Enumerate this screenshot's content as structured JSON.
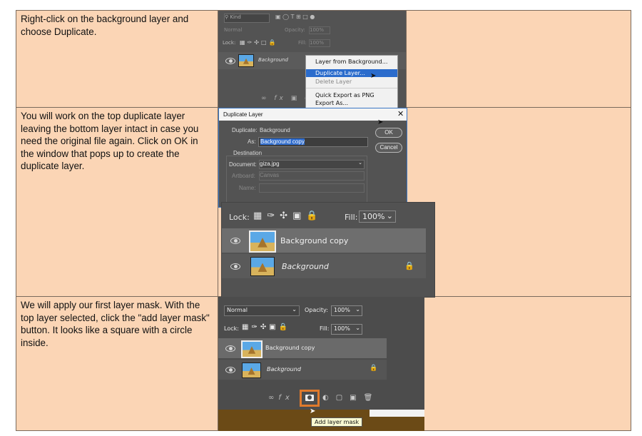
{
  "rows": [
    {
      "text": "Right-click on the background layer and choose Duplicate."
    },
    {
      "text": "You will work on the top duplicate layer leaving the bottom layer intact in case you need the original file again. Click on OK in the window that pops up to create the duplicate layer."
    },
    {
      "text": "We will apply our first layer mask. With the top layer selected, click the \"add layer mask\" button. It looks like a square with a circle inside."
    }
  ],
  "shot1": {
    "kind_placeholder": "Kind",
    "blend": "Normal",
    "opacity_label": "Opacity:",
    "opacity": "100%",
    "lock_label": "Lock:",
    "fill_label": "Fill:",
    "fill": "100%",
    "layer_name": "Background",
    "menu": [
      "Layer from Background...",
      "Duplicate Layer...",
      "Delete Layer",
      "Quick Export as PNG",
      "Export As..."
    ]
  },
  "shot2": {
    "title": "Duplicate Layer",
    "duplicate_label": "Duplicate:",
    "duplicate_value": "Background",
    "as_label": "As:",
    "as_value": "Background copy",
    "ok": "OK",
    "cancel": "Cancel",
    "destination": "Destination",
    "document_label": "Document:",
    "document_value": "giza.jpg",
    "artboard_label": "Artboard:",
    "artboard_value": "Canvas",
    "name_label": "Name:",
    "lock_label": "Lock:",
    "fill_label": "Fill:",
    "fill": "100%",
    "layer_top": "Background copy",
    "layer_bottom": "Background"
  },
  "shot3": {
    "blend": "Normal",
    "opacity_label": "Opacity:",
    "opacity": "100%",
    "lock_label": "Lock:",
    "fill_label": "Fill:",
    "fill": "100%",
    "layer_top": "Background copy",
    "layer_bottom": "Background",
    "tooltip": "Add layer mask"
  }
}
